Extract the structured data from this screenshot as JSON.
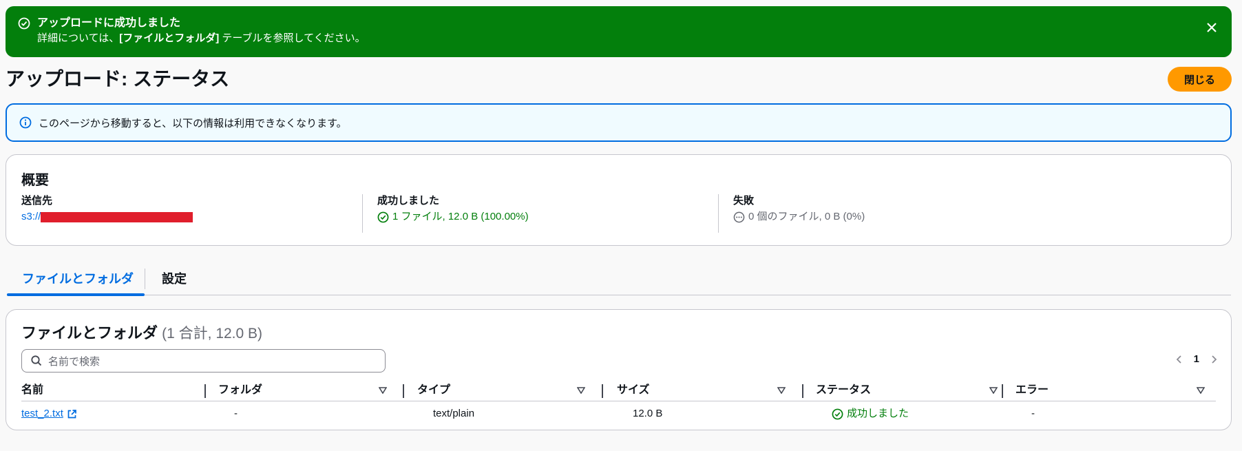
{
  "flash": {
    "title": "アップロードに成功しました",
    "desc_prefix": "詳細については、",
    "desc_bold": "[ファイルとフォルダ]",
    "desc_suffix": " テーブルを参照してください。"
  },
  "page": {
    "title": "アップロード: ステータス",
    "close_label": "閉じる"
  },
  "info": {
    "text": "このページから移動すると、以下の情報は利用できなくなります。"
  },
  "summary": {
    "title": "概要",
    "destination_label": "送信先",
    "destination_value": "s3://",
    "success_label": "成功しました",
    "success_value": "1 ファイル, 12.0 B (100.00%)",
    "failed_label": "失敗",
    "failed_value": "0 個のファイル, 0 B (0%)"
  },
  "tabs": [
    {
      "label": "ファイルとフォルダ",
      "active": true
    },
    {
      "label": "設定",
      "active": false
    }
  ],
  "files": {
    "title": "ファイルとフォルダ",
    "count": "(1 合計, 12.0 B)",
    "search_placeholder": "名前で検索",
    "page_number": "1",
    "columns": [
      "名前",
      "フォルダ",
      "タイプ",
      "サイズ",
      "ステータス",
      "エラー"
    ],
    "rows": [
      {
        "name": "test_2.txt",
        "folder": "-",
        "type": "text/plain",
        "size": "12.0 B",
        "status": "成功しました",
        "error": "-"
      }
    ]
  },
  "colors": {
    "success": "#037f0c",
    "link": "#006ce0",
    "primary_button": "#ff9900",
    "info_border": "#006ce0"
  }
}
